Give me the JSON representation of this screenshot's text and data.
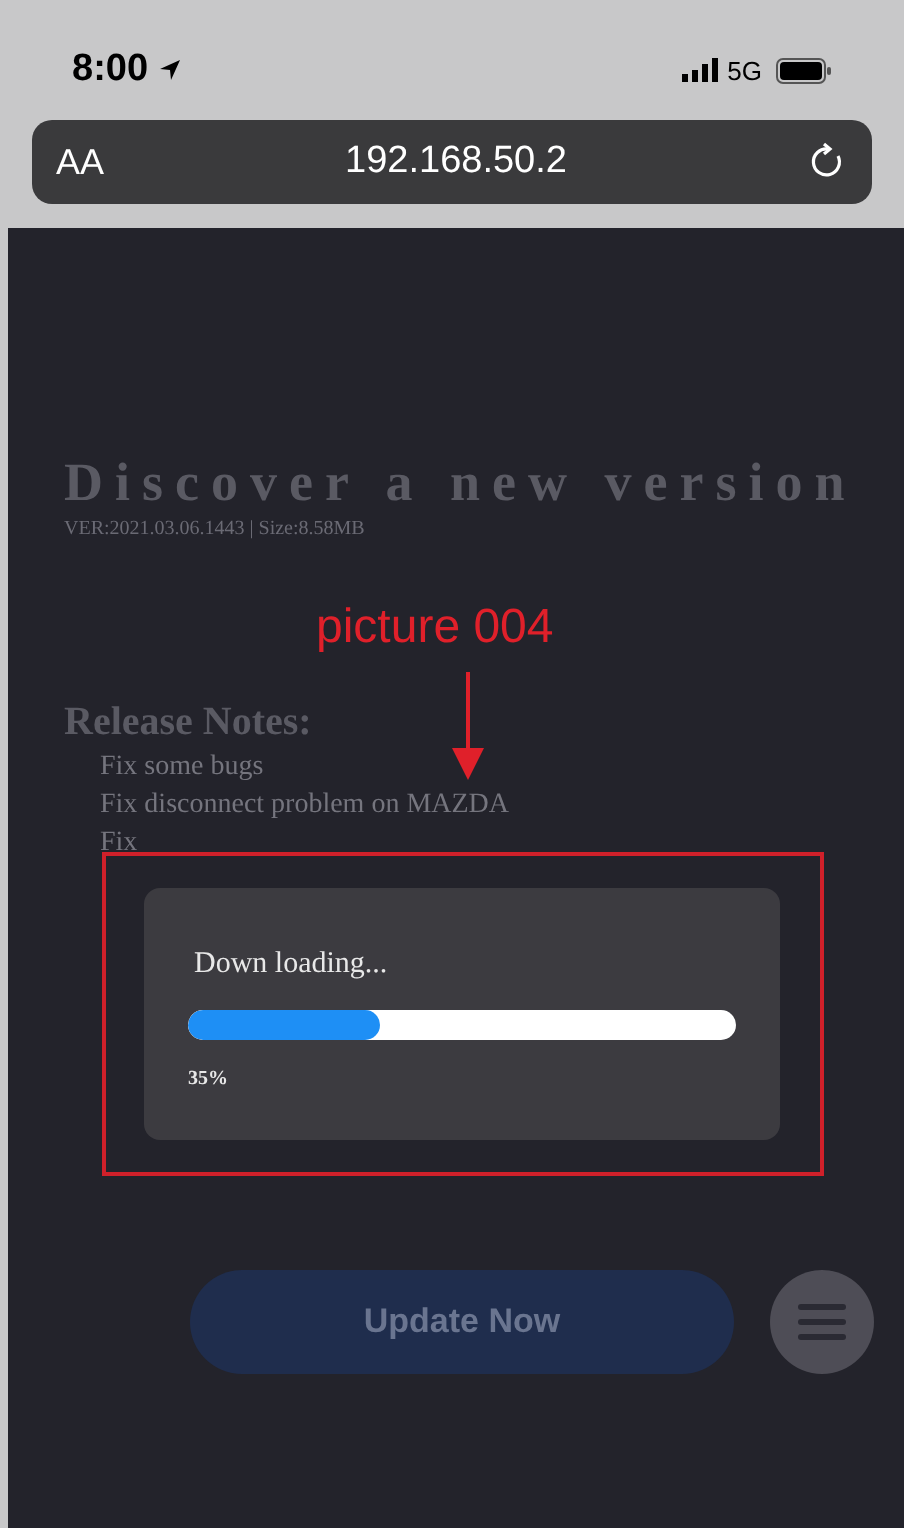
{
  "status_bar": {
    "time": "8:00",
    "network": "5G"
  },
  "address_bar": {
    "text_size_label": "AA",
    "url": "192.168.50.2"
  },
  "page": {
    "title": "Discover a new version",
    "version_info": "VER:2021.03.06.1443 | Size:8.58MB",
    "release_notes_heading": "Release Notes:",
    "release_notes": [
      "Fix some bugs",
      "Fix disconnect problem on MAZDA",
      "Fix"
    ],
    "update_button": {
      "label": "Update Now",
      "disabled": true
    }
  },
  "annotation": {
    "label": "picture 004"
  },
  "progress_dialog": {
    "message": "Down loading...",
    "level": 0.35,
    "reading": "35%"
  }
}
